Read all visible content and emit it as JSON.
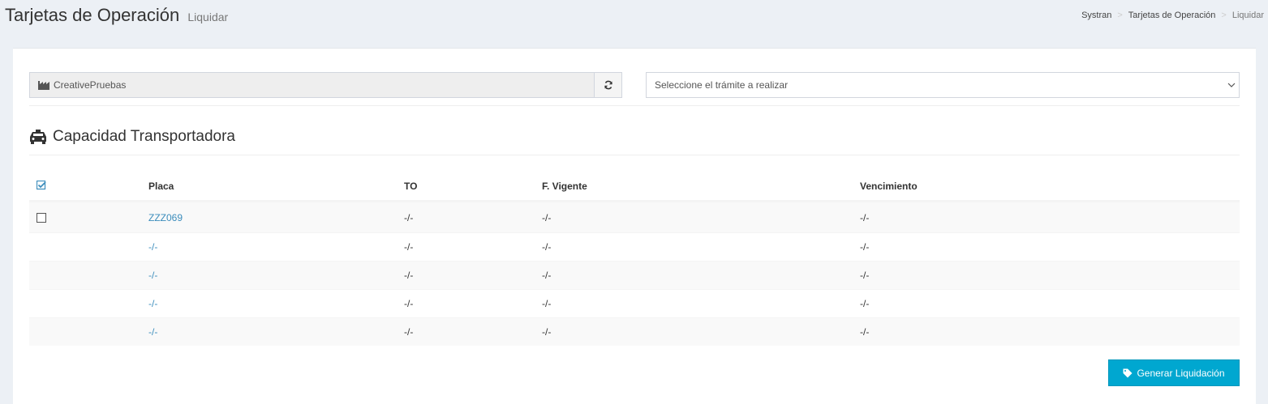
{
  "header": {
    "title": "Tarjetas de Operación",
    "subtitle": "Liquidar",
    "breadcrumb": [
      "Systran",
      "Tarjetas de Operación",
      "Liquidar"
    ],
    "breadcrumb_separator": ">"
  },
  "company": {
    "name": "CreativePruebas",
    "icon": "industry-icon",
    "refresh_icon": "refresh-icon"
  },
  "tramite_select": {
    "placeholder": "Seleccione el trámite a realizar"
  },
  "section": {
    "title": "Capacidad Transportadora",
    "icon": "taxi-icon"
  },
  "table": {
    "headers": [
      "Placa",
      "TO",
      "F. Vigente",
      "Vencimiento"
    ],
    "select_all_icon": "check-square-icon",
    "rows": [
      {
        "placa": "ZZZ069",
        "to": "-/-",
        "vigente": "-/-",
        "vencimiento": "-/-",
        "checkbox": true
      },
      {
        "placa": "-/-",
        "to": "-/-",
        "vigente": "-/-",
        "vencimiento": "-/-",
        "checkbox": false
      },
      {
        "placa": "-/-",
        "to": "-/-",
        "vigente": "-/-",
        "vencimiento": "-/-",
        "checkbox": false
      },
      {
        "placa": "-/-",
        "to": "-/-",
        "vigente": "-/-",
        "vencimiento": "-/-",
        "checkbox": false
      },
      {
        "placa": "-/-",
        "to": "-/-",
        "vigente": "-/-",
        "vencimiento": "-/-",
        "checkbox": false
      }
    ]
  },
  "actions": {
    "generate_label": "Generar Liquidación",
    "generate_icon": "tag-icon"
  },
  "colors": {
    "accent": "#00a7d0",
    "link": "#3c8dbc",
    "background": "#ecf0f5"
  }
}
